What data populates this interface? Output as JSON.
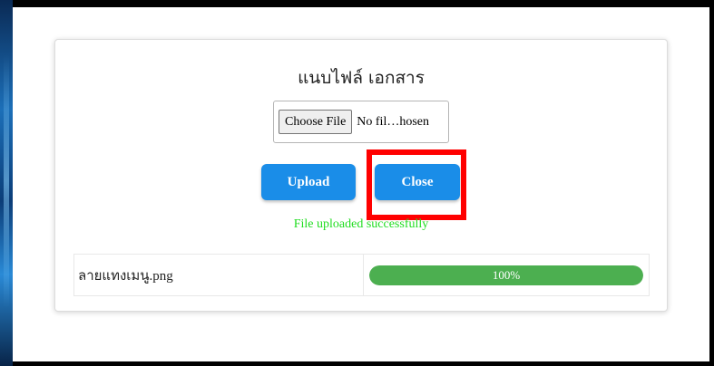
{
  "dialog": {
    "title": "แนบไฟล์ เอกสาร",
    "file_input": {
      "button_label": "Choose File",
      "status_text": "No fil…hosen"
    },
    "upload_label": "Upload",
    "close_label": "Close",
    "status_message": "File uploaded successfully"
  },
  "files": [
    {
      "name": "ลายแทงเมนู.png",
      "progress_label": "100%",
      "progress_fraction": 1.0
    }
  ],
  "colors": {
    "button": "#1a8de8",
    "progress": "#4caf50",
    "success_text": "#22dd22",
    "highlight": "#ff0000"
  }
}
